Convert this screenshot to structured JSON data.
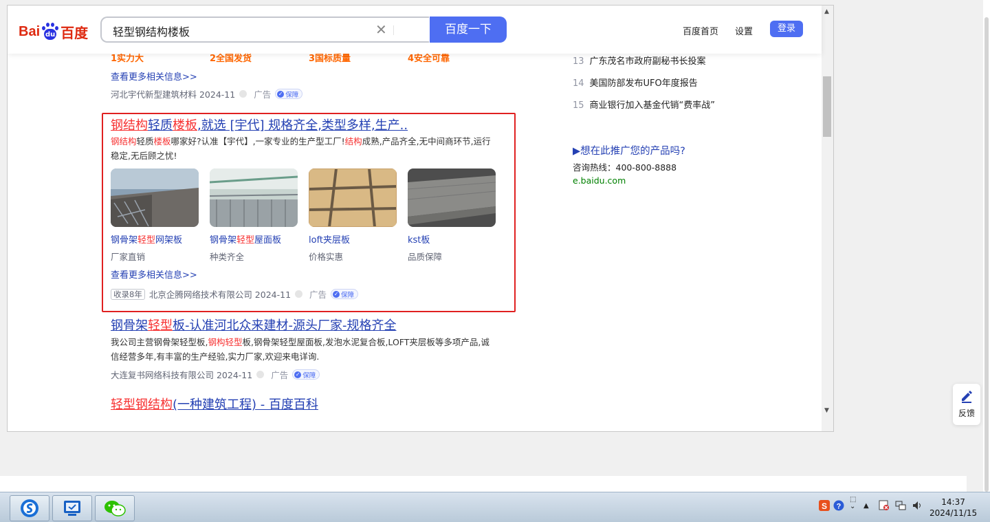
{
  "header": {
    "logo_text_left": "Bai",
    "logo_text_paw": "du",
    "logo_text_cn": "百度",
    "search_value": "轻型钢结构楼板",
    "search_button": "百度一下",
    "link_home": "百度首页",
    "link_settings": "设置",
    "login_button": "登录"
  },
  "result0": {
    "highlights": [
      "1实力大",
      "2全国发货",
      "3国标质量",
      "4安全可靠"
    ],
    "more_link": "查看更多相关信息>>",
    "source": "河北宇代新型建筑材料 2024-11",
    "ad_label": "广告",
    "badge": "保障"
  },
  "result1": {
    "title_parts": [
      "钢结构",
      "轻质",
      "楼板",
      ",就选 [宇代] 规格齐全,类型多样,生产.."
    ],
    "desc_parts": [
      "钢结构",
      "轻质",
      "楼板",
      "哪家好?认准【宇代】,一家专业的生产型工厂!",
      "结构",
      "成熟,产品齐全,无中间商环节,运行稳定,无后顾之忧!"
    ],
    "cards": [
      {
        "title_a": "钢骨架",
        "title_r": "轻型",
        "title_b": "网架板",
        "sub": "厂家直销"
      },
      {
        "title_a": "钢骨架",
        "title_r": "轻型",
        "title_b": "屋面板",
        "sub": "种类齐全"
      },
      {
        "title_a": "loft夹层板",
        "title_r": "",
        "title_b": "",
        "sub": "价格实惠"
      },
      {
        "title_a": "kst板",
        "title_r": "",
        "title_b": "",
        "sub": "品质保障"
      }
    ],
    "more_link": "查看更多相关信息>>",
    "age_tag": "收录8年",
    "source": "北京企腾网络技术有限公司 2024-11",
    "ad_label": "广告",
    "badge": "保障"
  },
  "result2": {
    "title_parts": [
      "钢骨架",
      "轻型",
      "板-认准河北众来建材-源头厂家-规格齐全"
    ],
    "desc_parts": [
      "我公司主营钢骨架轻型板,",
      "钢构轻型",
      "板,钢骨架轻型屋面板,发泡水泥复合板,LOFT夹层板等多项产品,诚信经营多年,有丰富的生产经验,实力厂家,欢迎来电详询."
    ],
    "source": "大连复书网络科技有限公司 2024-11",
    "ad_label": "广告",
    "badge": "保障"
  },
  "result3": {
    "title_parts": [
      "轻型钢结构",
      "(一种建筑工程) - 百度百科"
    ]
  },
  "hot_list": [
    {
      "num": "13",
      "text": "广东茂名市政府副秘书长投案"
    },
    {
      "num": "14",
      "text": "美国防部发布UFO年度报告"
    },
    {
      "num": "15",
      "text": "商业银行加入基金代销“费率战”"
    }
  ],
  "promo": {
    "title": "▶想在此推广您的产品吗?",
    "hotline": "咨询热线：400-800-8888",
    "site": "e.baidu.com"
  },
  "feedback_label": "反馈",
  "clock": {
    "time": "14:37",
    "date": "2024/11/15"
  }
}
